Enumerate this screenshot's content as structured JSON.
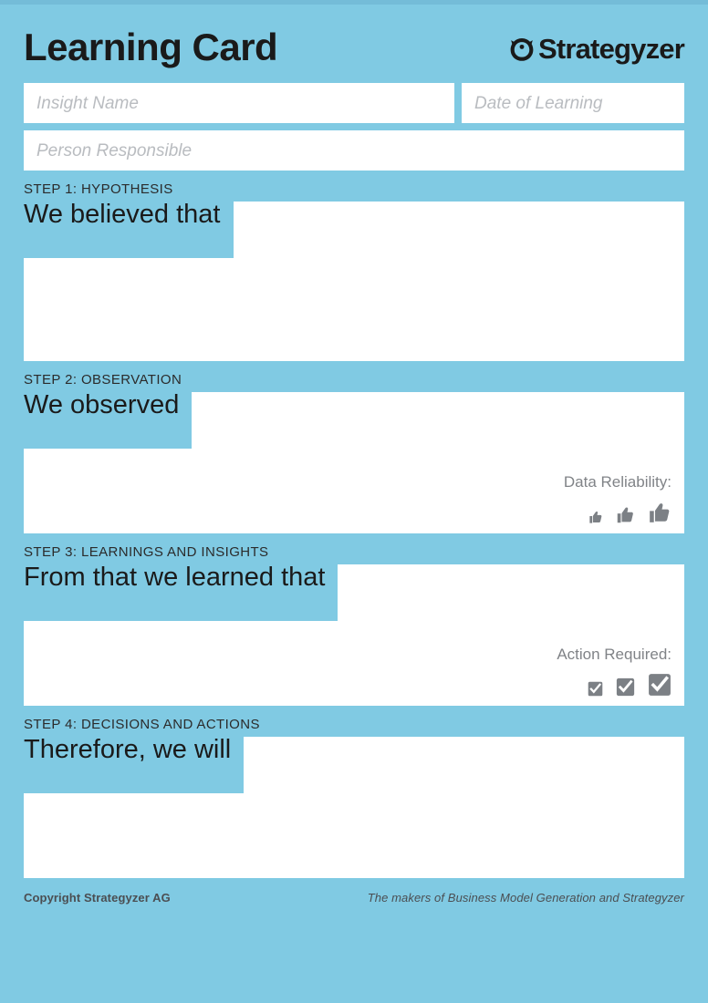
{
  "theme": {
    "background": "#80cae3",
    "top_band": "#74bcd8",
    "field_background": "#ffffff",
    "placeholder_color": "#b9bcc0",
    "text_color": "#1a1a1a",
    "muted_color": "#808387",
    "footer_color": "#4b4e52",
    "icon_gray": "#7c8085"
  },
  "header": {
    "title": "Learning Card",
    "brand": {
      "mark": "strategyzer-owl-icon",
      "name": "Strategyzer"
    }
  },
  "meta_fields": {
    "insight_name": {
      "placeholder": "Insight Name",
      "value": ""
    },
    "date_of_learning": {
      "placeholder": "Date of Learning",
      "value": ""
    },
    "person_responsible": {
      "placeholder": "Person Responsible",
      "value": ""
    }
  },
  "steps": [
    {
      "label": "STEP 1: HYPOTHESIS",
      "prompt": "We believed that",
      "value": "",
      "rating": null
    },
    {
      "label": "STEP 2: OBSERVATION",
      "prompt": "We observed",
      "value": "",
      "rating": {
        "label": "Data Reliability:",
        "icon": "thumbs-up-icon",
        "options": [
          "low",
          "medium",
          "high"
        ]
      }
    },
    {
      "label": "STEP 3: LEARNINGS AND INSIGHTS",
      "prompt": "From that we learned that",
      "value": "",
      "rating": {
        "label": "Action Required:",
        "icon": "checkbox-checked-icon",
        "options": [
          "low",
          "medium",
          "high"
        ]
      }
    },
    {
      "label": "STEP 4: DECISIONS AND ACTIONS",
      "prompt": "Therefore, we will",
      "value": "",
      "rating": null
    }
  ],
  "footer": {
    "copyright": "Copyright Strategyzer AG",
    "tagline": "The makers of Business Model Generation and Strategyzer"
  }
}
